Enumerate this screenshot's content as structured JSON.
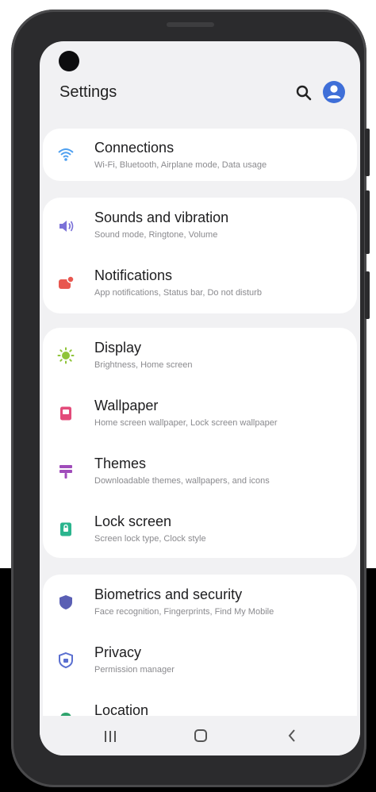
{
  "header": {
    "title": "Settings"
  },
  "groups": [
    {
      "items": [
        {
          "title": "Connections",
          "subtitle": "Wi-Fi, Bluetooth, Airplane mode, Data usage",
          "icon": "wifi-icon",
          "color": "#4d9ff0"
        }
      ]
    },
    {
      "items": [
        {
          "title": "Sounds and vibration",
          "subtitle": "Sound mode, Ringtone, Volume",
          "icon": "volume-icon",
          "color": "#7b72d8"
        },
        {
          "title": "Notifications",
          "subtitle": "App notifications, Status bar, Do not disturb",
          "icon": "notification-icon",
          "color": "#e8574f"
        }
      ]
    },
    {
      "items": [
        {
          "title": "Display",
          "subtitle": "Brightness, Home screen",
          "icon": "brightness-icon",
          "color": "#8fc439"
        },
        {
          "title": "Wallpaper",
          "subtitle": "Home screen wallpaper, Lock screen wallpaper",
          "icon": "wallpaper-icon",
          "color": "#e34b7a"
        },
        {
          "title": "Themes",
          "subtitle": "Downloadable themes, wallpapers, and icons",
          "icon": "themes-icon",
          "color": "#a04cba"
        },
        {
          "title": "Lock screen",
          "subtitle": "Screen lock type, Clock style",
          "icon": "lock-screen-icon",
          "color": "#2bb58e"
        }
      ]
    },
    {
      "items": [
        {
          "title": "Biometrics and security",
          "subtitle": "Face recognition, Fingerprints, Find My Mobile",
          "icon": "shield-icon",
          "color": "#5a5fb4"
        },
        {
          "title": "Privacy",
          "subtitle": "Permission manager",
          "icon": "privacy-icon",
          "color": "#5a6fd0"
        },
        {
          "title": "Location",
          "subtitle": "",
          "icon": "location-icon",
          "color": "#2ea36c"
        }
      ]
    }
  ],
  "colors": {
    "accent": "#3f6fd8",
    "screen_bg": "#f1f1f3",
    "card_bg": "#ffffff"
  }
}
